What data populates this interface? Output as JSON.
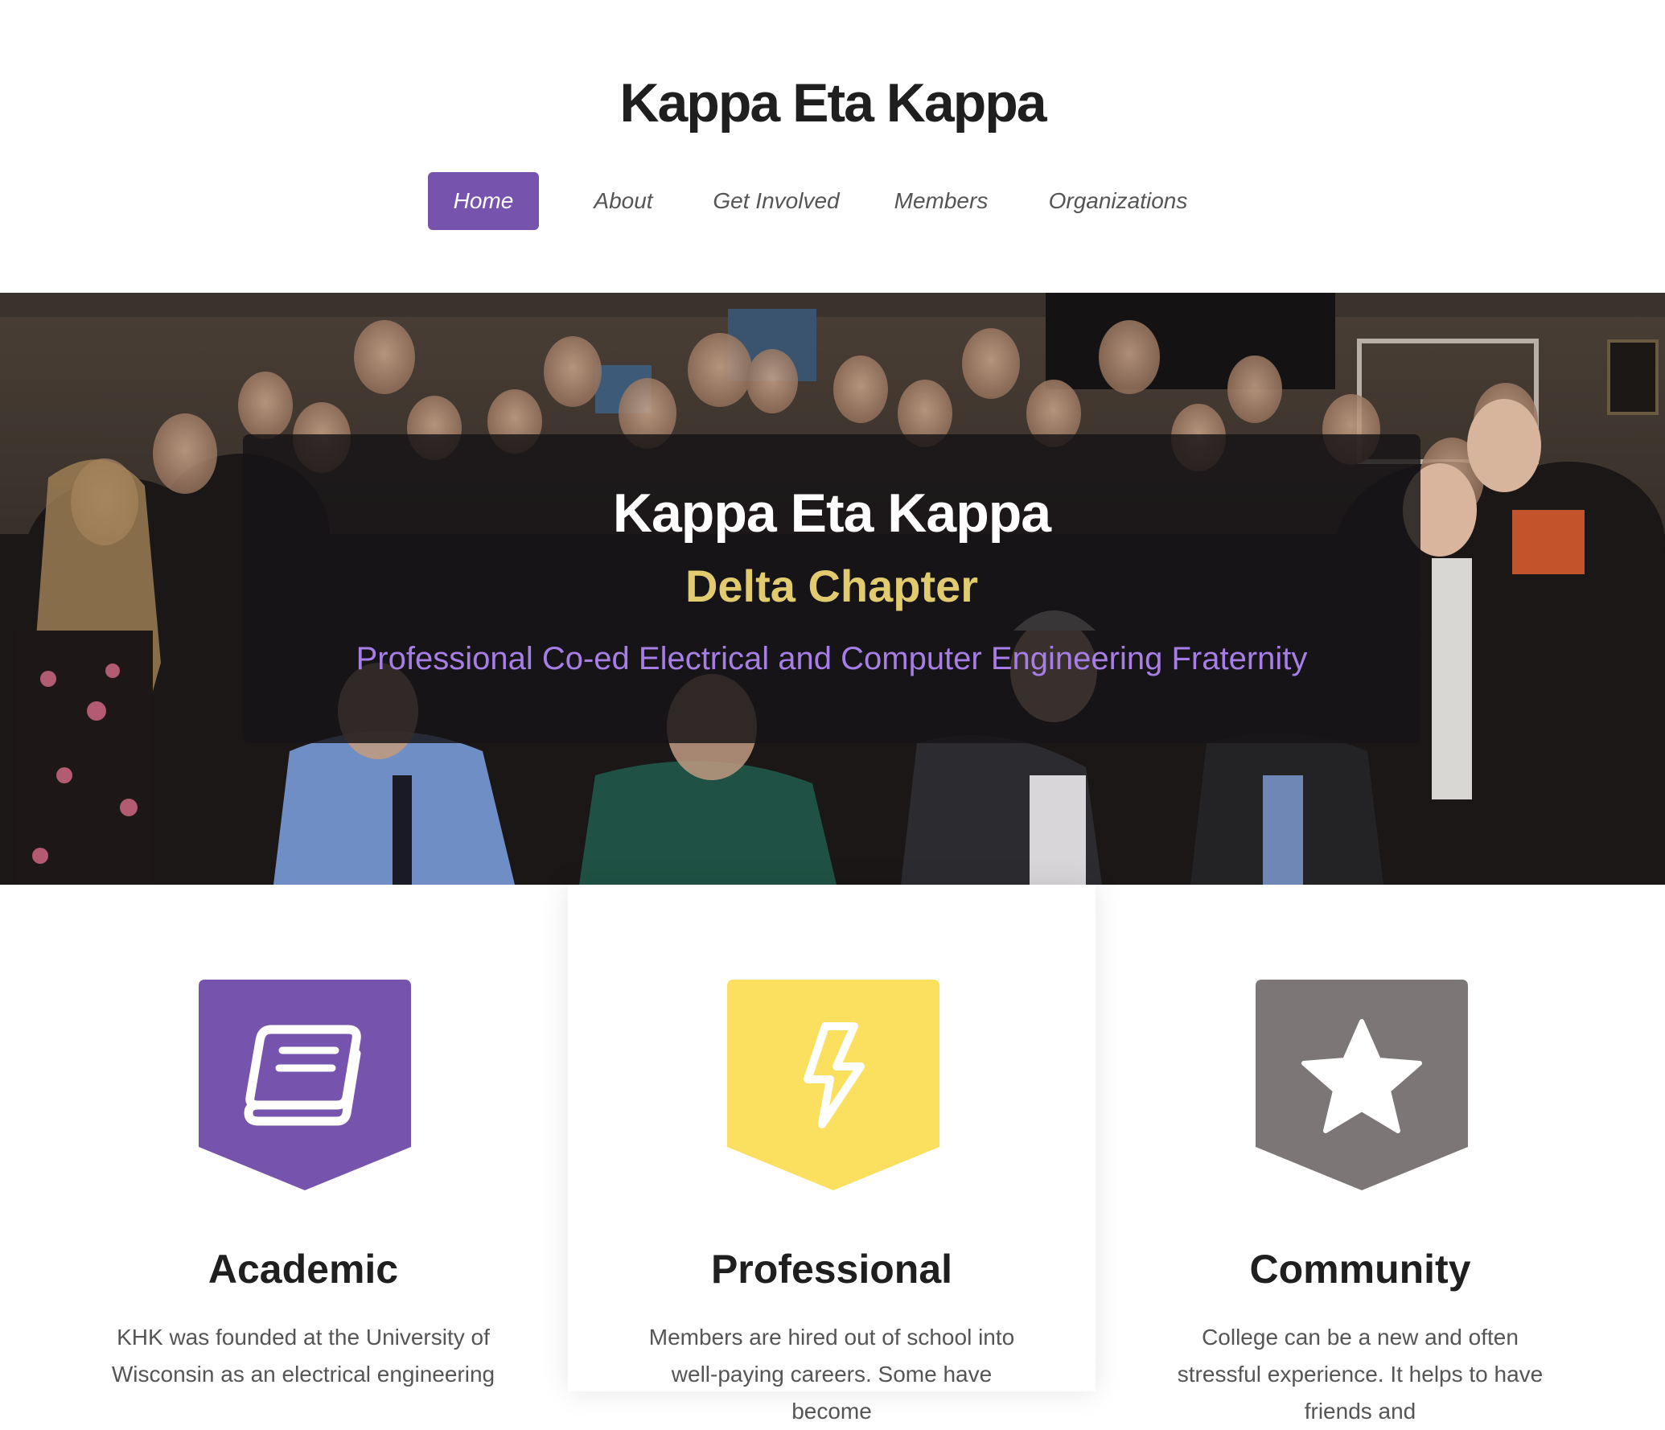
{
  "header": {
    "site_title": "Kappa Eta Kappa",
    "nav": [
      {
        "label": "Home",
        "active": true
      },
      {
        "label": "About",
        "active": false
      },
      {
        "label": "Get Involved",
        "active": false
      },
      {
        "label": "Members",
        "active": false
      },
      {
        "label": "Organizations",
        "active": false
      }
    ]
  },
  "hero": {
    "title": "Kappa Eta Kappa",
    "subtitle": "Delta Chapter",
    "tagline": "Professional Co-ed Electrical and Computer Engineering Fraternity"
  },
  "features": [
    {
      "title": "Academic",
      "text": "KHK was founded at the University of Wisconsin as an electrical engineering",
      "icon": "book-icon",
      "color": "#7654ae"
    },
    {
      "title": "Professional",
      "text": "Members are hired out of school into well-paying careers. Some have become",
      "icon": "lightning-bolt-icon",
      "color": "#fbe060"
    },
    {
      "title": "Community",
      "text": "College can be a new and often stressful experience. It helps to have friends and",
      "icon": "star-icon",
      "color": "#7c7676"
    }
  ],
  "colors": {
    "accent": "#7654ae",
    "gold": "#e1cb6e",
    "tagline": "#a77ee6"
  }
}
